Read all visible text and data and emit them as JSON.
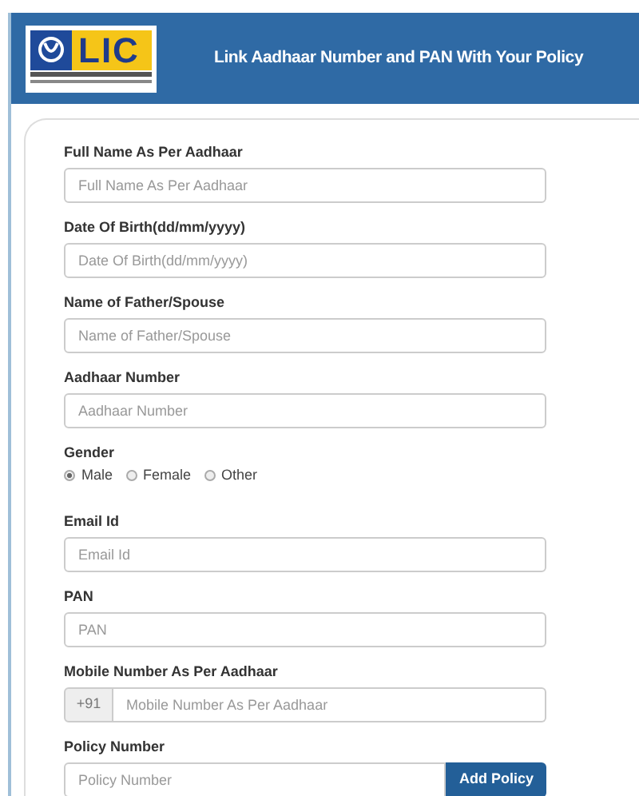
{
  "header": {
    "logo_text": "LIC",
    "title": "Link Aadhaar Number and PAN With Your Policy"
  },
  "fields": [
    {
      "kind": "text",
      "label": "Full Name As Per Aadhaar",
      "placeholder": "Full Name As Per Aadhaar"
    },
    {
      "kind": "text",
      "label": "Date Of Birth(dd/mm/yyyy)",
      "placeholder": "Date Of Birth(dd/mm/yyyy)"
    },
    {
      "kind": "text",
      "label": "Name of Father/Spouse",
      "placeholder": "Name of Father/Spouse"
    },
    {
      "kind": "text",
      "label": "Aadhaar Number",
      "placeholder": "Aadhaar Number"
    },
    {
      "kind": "radio",
      "label": "Gender",
      "options": [
        {
          "label": "Male",
          "selected": true
        },
        {
          "label": "Female",
          "selected": false
        },
        {
          "label": "Other",
          "selected": false
        }
      ]
    },
    {
      "kind": "text",
      "label": "Email Id",
      "placeholder": "Email Id"
    },
    {
      "kind": "text",
      "label": "PAN",
      "placeholder": "PAN"
    },
    {
      "kind": "prefix",
      "label": "Mobile Number As Per Aadhaar",
      "prefix": "+91",
      "placeholder": "Mobile Number As Per Aadhaar"
    },
    {
      "kind": "button",
      "label": "Policy Number",
      "placeholder": "Policy Number",
      "button": "Add Policy"
    }
  ]
}
